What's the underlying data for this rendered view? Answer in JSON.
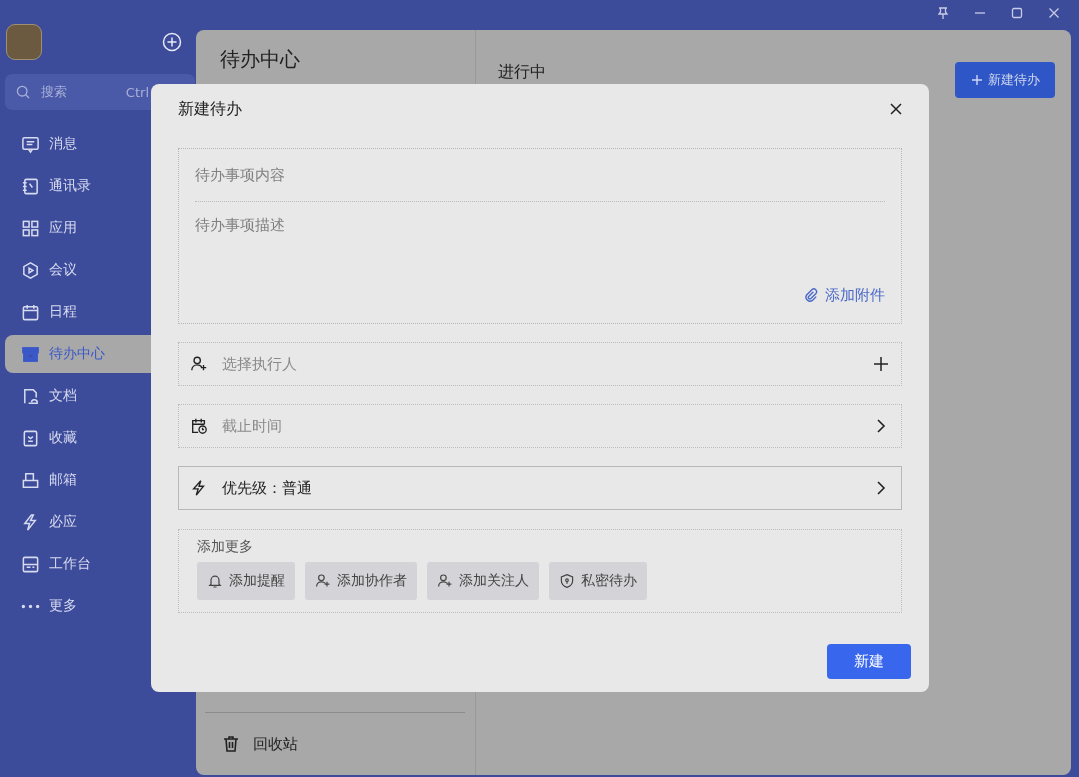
{
  "sidebar": {
    "search": {
      "placeholder": "搜索",
      "shortcut": "Ctrl"
    },
    "items": [
      {
        "label": "消息",
        "kind": "message",
        "selected": false
      },
      {
        "label": "通讯录",
        "kind": "contacts",
        "selected": false
      },
      {
        "label": "应用",
        "kind": "apps",
        "selected": false
      },
      {
        "label": "会议",
        "kind": "meeting",
        "selected": false
      },
      {
        "label": "日程",
        "kind": "calendar",
        "selected": false
      },
      {
        "label": "待办中心",
        "kind": "todo",
        "selected": true
      },
      {
        "label": "文档",
        "kind": "docs",
        "selected": false
      },
      {
        "label": "收藏",
        "kind": "favorites",
        "selected": false
      },
      {
        "label": "邮箱",
        "kind": "mail",
        "selected": false
      },
      {
        "label": "必应",
        "kind": "bolt",
        "selected": false
      },
      {
        "label": "工作台",
        "kind": "workbench",
        "selected": false
      },
      {
        "label": "更多",
        "kind": "more",
        "selected": false
      }
    ]
  },
  "todo_panel": {
    "title": "待办中心",
    "trash": "回收站"
  },
  "content": {
    "tab": "进行中",
    "new_button": "新建待办"
  },
  "dialog": {
    "title": "新建待办",
    "content_placeholder": "待办事项内容",
    "description_placeholder": "待办事项描述",
    "attachment": "添加附件",
    "rows": [
      {
        "kind": "assignee",
        "label": "选择执行人",
        "placeholder": true
      },
      {
        "kind": "deadline",
        "label": "截止时间",
        "placeholder": true
      },
      {
        "kind": "priority",
        "label": "优先级：普通",
        "placeholder": false
      }
    ],
    "more": {
      "title": "添加更多",
      "chips": [
        {
          "kind": "reminder",
          "label": "添加提醒"
        },
        {
          "kind": "collaborator",
          "label": "添加协作者"
        },
        {
          "kind": "follower",
          "label": "添加关注人"
        },
        {
          "kind": "private",
          "label": "私密待办"
        }
      ]
    },
    "submit": "新建"
  }
}
